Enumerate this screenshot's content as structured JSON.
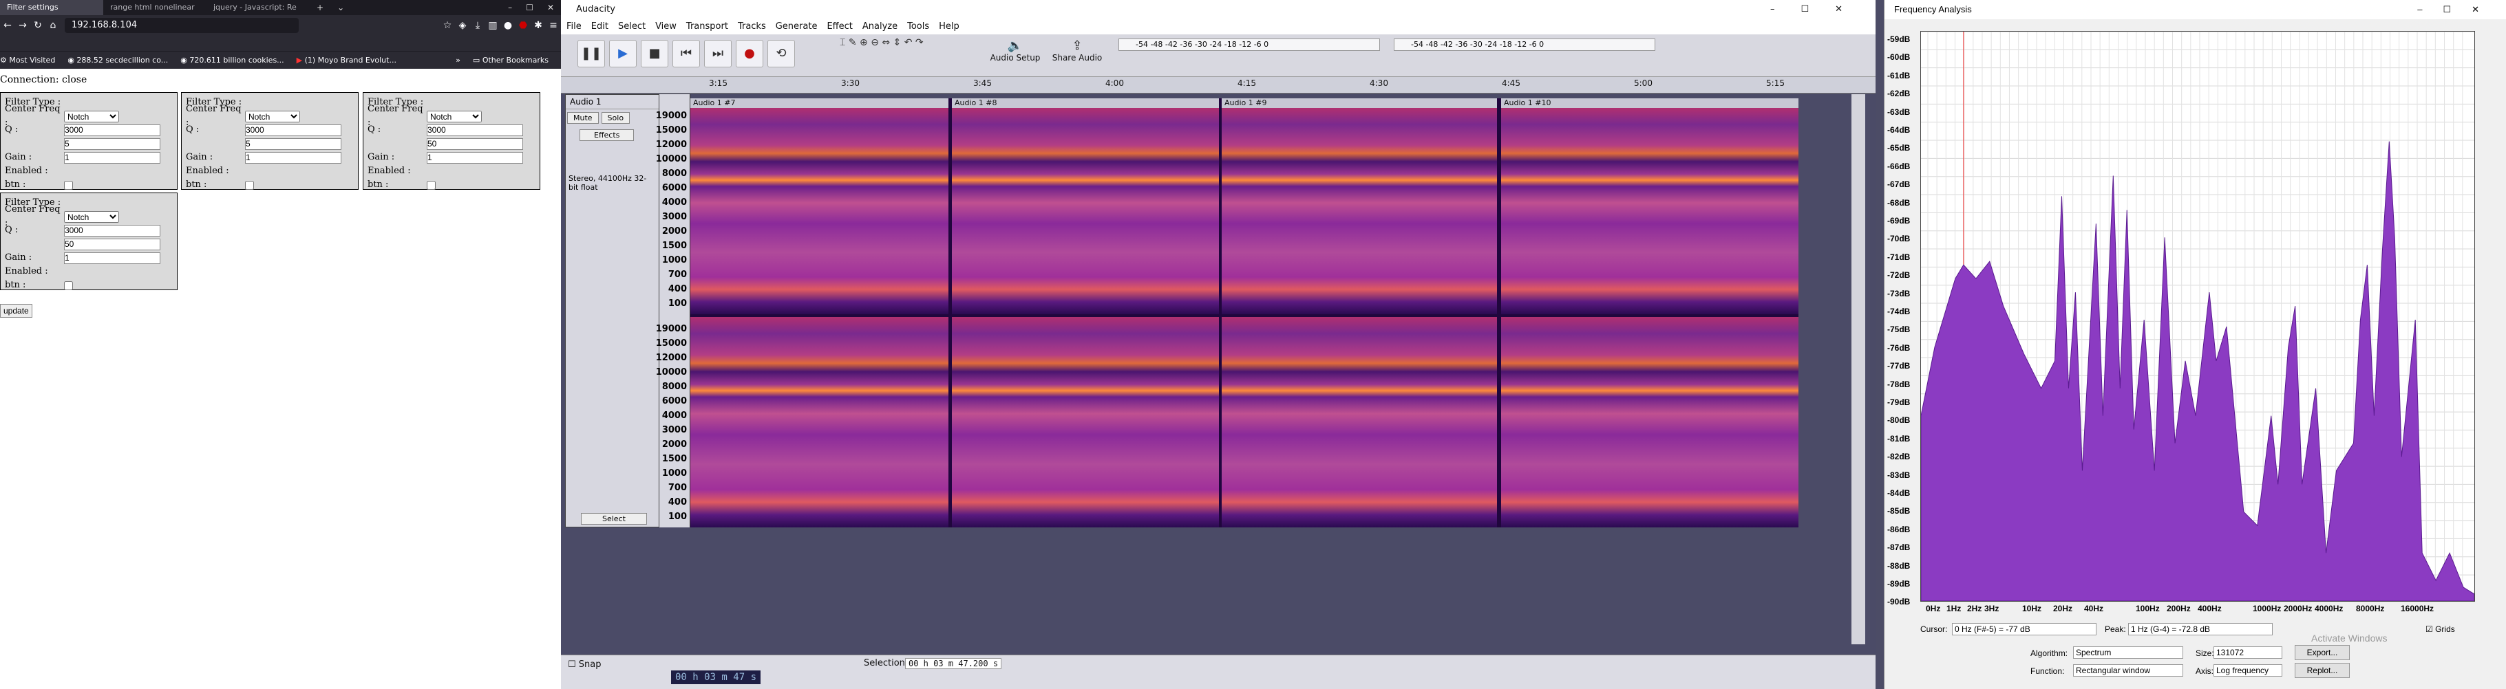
{
  "firefox": {
    "tabs": [
      "Filter settings",
      "range html nonelinear",
      "jquery - Javascript: Re"
    ],
    "url": "192.168.8.104",
    "bookmarks": [
      "Most Visited",
      "288.52 secdecillion co...",
      "720.611 billion cookies...",
      "(1) Moyo Brand Evolut..."
    ],
    "other_bookmarks": "Other Bookmarks",
    "page": {
      "connection": "Connection: close",
      "labels": {
        "filter_type": "Filter Type :",
        "center_freq": "Center Freq :",
        "q": "Q :",
        "gain": "Gain :",
        "enabled": "Enabled :",
        "btn": "btn :"
      },
      "filters": [
        {
          "type": "Notch",
          "freq": "3000",
          "q": "5",
          "gain": "1"
        },
        {
          "type": "Notch",
          "freq": "3000",
          "q": "5",
          "gain": "1"
        },
        {
          "type": "Notch",
          "freq": "3000",
          "q": "50",
          "gain": "1"
        },
        {
          "type": "Notch",
          "freq": "3000",
          "q": "50",
          "gain": "1"
        }
      ],
      "update_label": "update"
    }
  },
  "audacity": {
    "title": "Audacity",
    "menu": [
      "File",
      "Edit",
      "Select",
      "View",
      "Transport",
      "Tracks",
      "Generate",
      "Effect",
      "Analyze",
      "Tools",
      "Help"
    ],
    "audio_setup": "Audio Setup",
    "share_audio": "Share Audio",
    "meter_ticks": "-54 -48 -42 -36 -30 -24 -18 -12 -6 0",
    "timeline": [
      "3:15",
      "3:30",
      "3:45",
      "4:00",
      "4:15",
      "4:30",
      "4:45",
      "5:00",
      "5:15"
    ],
    "track": {
      "name": "Audio 1",
      "mute": "Mute",
      "solo": "Solo",
      "effects": "Effects",
      "info": "Stereo, 44100Hz 32-bit float",
      "select": "Select"
    },
    "scale_labels": [
      "19000",
      "15000",
      "12000",
      "10000",
      "8000",
      "6000",
      "4000",
      "3000",
      "2000",
      "1500",
      "1000",
      "700",
      "400",
      "100"
    ],
    "clips": [
      "Audio 1 #7",
      "Audio 1 #8",
      "Audio 1 #9",
      "Audio 1 #10"
    ],
    "bottom": {
      "snap": "Snap",
      "selection": "Selection",
      "sel_value": "00 h 03 m 47.200 s",
      "time_value": "00 h 03 m 47 s"
    }
  },
  "freq": {
    "title": "Frequency Analysis",
    "y_labels": [
      "-59dB",
      "-60dB",
      "-61dB",
      "-62dB",
      "-63dB",
      "-64dB",
      "-65dB",
      "-66dB",
      "-67dB",
      "-68dB",
      "-69dB",
      "-70dB",
      "-71dB",
      "-72dB",
      "-73dB",
      "-74dB",
      "-75dB",
      "-76dB",
      "-77dB",
      "-78dB",
      "-79dB",
      "-80dB",
      "-81dB",
      "-82dB",
      "-83dB",
      "-84dB",
      "-85dB",
      "-86dB",
      "-87dB",
      "-88dB",
      "-89dB",
      "-90dB"
    ],
    "x_labels": [
      "0Hz",
      "1Hz",
      "2Hz",
      "3Hz",
      "10Hz",
      "20Hz",
      "40Hz",
      "100Hz",
      "200Hz",
      "400Hz",
      "1000Hz",
      "2000Hz",
      "4000Hz",
      "8000Hz",
      "16000Hz"
    ],
    "cursor_label": "Cursor:",
    "cursor_value": "0 Hz (F#-5) = -77 dB",
    "peak_label": "Peak:",
    "peak_value": "1 Hz (G-4) = -72.8 dB",
    "grids": "Grids",
    "algorithm_label": "Algorithm:",
    "algorithm": "Spectrum",
    "size_label": "Size:",
    "size": "131072",
    "export": "Export...",
    "function_label": "Function:",
    "function": "Rectangular window",
    "axis_label": "Axis:",
    "axis": "Log frequency",
    "replot": "Replot...",
    "watermark": "Activate Windows"
  }
}
